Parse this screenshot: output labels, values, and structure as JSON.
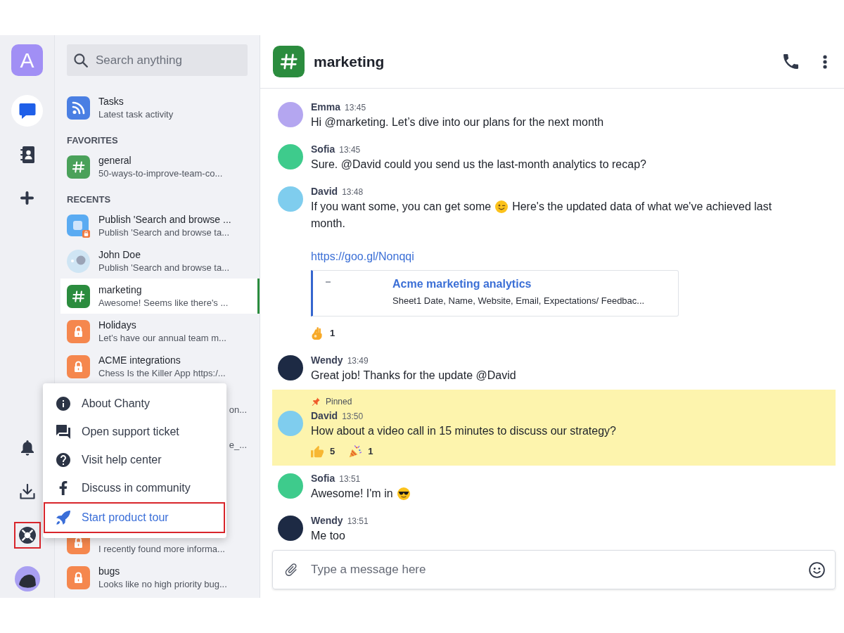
{
  "rail": {
    "workspace": {
      "initial": "A"
    },
    "top_items": [
      {
        "kind": "chats",
        "selected": true
      },
      {
        "kind": "contacts",
        "selected": false
      },
      {
        "kind": "new",
        "selected": false
      }
    ],
    "bottom_items": [
      {
        "kind": "notifications",
        "highlighted": false
      },
      {
        "kind": "downloads",
        "highlighted": false
      },
      {
        "kind": "help",
        "highlighted": true
      },
      {
        "kind": "profile",
        "highlighted": false
      }
    ]
  },
  "sidebar": {
    "search": {
      "placeholder": "Search anything"
    },
    "top_items": [
      {
        "kind": "feed",
        "title": "Tasks",
        "subtitle": "Latest task activity",
        "color": "#4a7fe3",
        "selected": false
      }
    ],
    "sections": [
      {
        "heading": "FAVORITES",
        "items": [
          {
            "kind": "public",
            "title": "general",
            "subtitle": "50-ways-to-improve-team-co...",
            "color": "#4aa15a",
            "selected": false
          }
        ]
      },
      {
        "heading": "RECENTS",
        "items": [
          {
            "kind": "app",
            "title": "Publish 'Search and browse ...",
            "subtitle": "Publish 'Search and browse ta...",
            "color": "#5aabf2",
            "selected": false
          },
          {
            "kind": "person",
            "title": "John Doe",
            "subtitle": "Publish 'Search and browse ta...",
            "color": "#cfe5f4",
            "selected": false
          },
          {
            "kind": "public",
            "title": "marketing",
            "subtitle": "Awesome! Seems like there's ...",
            "color": "#2b8c3e",
            "selected": true
          },
          {
            "kind": "private",
            "title": "Holidays",
            "subtitle": "Let’s have our annual team m...",
            "color": "#f5874e",
            "selected": false
          },
          {
            "kind": "private",
            "title": "ACME integrations",
            "subtitle": "Chess Is the Killer App https:/...",
            "color": "#f5874e",
            "selected": false
          },
          {
            "kind": "covered",
            "subtitle": "on...",
            "selected": false
          },
          {
            "kind": "covered",
            "subtitle": "e_...",
            "selected": false
          },
          {
            "kind": "private",
            "subtitle": "I recently found more informa...",
            "color": "#f5874e",
            "selected": false
          },
          {
            "kind": "private",
            "title": "bugs",
            "subtitle": "Looks like no high priority bug...",
            "color": "#f5874e",
            "selected": false
          }
        ]
      }
    ]
  },
  "help_menu": {
    "items": [
      {
        "kind": "info",
        "label": "About Chanty",
        "highlighted": false
      },
      {
        "kind": "ticket",
        "label": "Open support ticket",
        "highlighted": false
      },
      {
        "kind": "help",
        "label": "Visit help center",
        "highlighted": false
      },
      {
        "kind": "community",
        "label": "Discuss in community",
        "highlighted": false
      },
      {
        "kind": "tour",
        "label": "Start product tour",
        "highlighted": true
      }
    ]
  },
  "chat": {
    "header": {
      "title": "marketing",
      "color": "#2b8c3e"
    },
    "messages": [
      {
        "author": "Emma",
        "time": "13:45",
        "color": "#b4a6f0",
        "pinned": false,
        "parts": [
          {
            "kind": "text",
            "text": "Hi @marketing. Let’s dive into our plans for the next month"
          }
        ]
      },
      {
        "author": "Sofia",
        "time": "13:45",
        "color": "#3ecb8c",
        "pinned": false,
        "parts": [
          {
            "kind": "text",
            "text": "Sure. @David could you send us the last-month analytics to recap?"
          }
        ]
      },
      {
        "author": "David",
        "time": "13:48",
        "color": "#7fcdee",
        "pinned": false,
        "parts": [
          {
            "kind": "text",
            "text": "If you want some, you can get some"
          },
          {
            "kind": "wink"
          },
          {
            "kind": "text",
            "text": "Here's the updated data of what we've achieved last"
          },
          {
            "kind": "text",
            "text": "month."
          }
        ],
        "link": "https://goo.gl/Nonqqi",
        "preview": {
          "title": "Acme marketing analytics",
          "description": "Sheet1 Date, Name, Website, Email, Expectations/ Feedbac..."
        },
        "reactions": [
          {
            "kind": "ok",
            "count": "1"
          }
        ]
      },
      {
        "author": "Wendy",
        "time": "13:49",
        "color": "#1d2a44",
        "pinned": false,
        "parts": [
          {
            "kind": "text",
            "text": "Great job! Thanks for the update @David"
          }
        ]
      },
      {
        "author": "David",
        "time": "13:50",
        "color": "#7fcdee",
        "pinned": true,
        "pin_label": "Pinned",
        "parts": [
          {
            "kind": "text",
            "text": "How about a video call in 15 minutes to discuss our strategy?"
          }
        ],
        "reactions": [
          {
            "kind": "thumbs-up",
            "count": "5"
          },
          {
            "kind": "party",
            "count": "1"
          }
        ]
      },
      {
        "author": "Sofia",
        "time": "13:51",
        "color": "#3ecb8c",
        "pinned": false,
        "parts": [
          {
            "kind": "text",
            "text": "Awesome! I'm in"
          },
          {
            "kind": "sunglasses"
          }
        ]
      },
      {
        "author": "Wendy",
        "time": "13:51",
        "color": "#1d2a44",
        "pinned": false,
        "parts": [
          {
            "kind": "text",
            "text": "Me too"
          }
        ]
      }
    ],
    "composer": {
      "placeholder": "Type a message here"
    }
  }
}
